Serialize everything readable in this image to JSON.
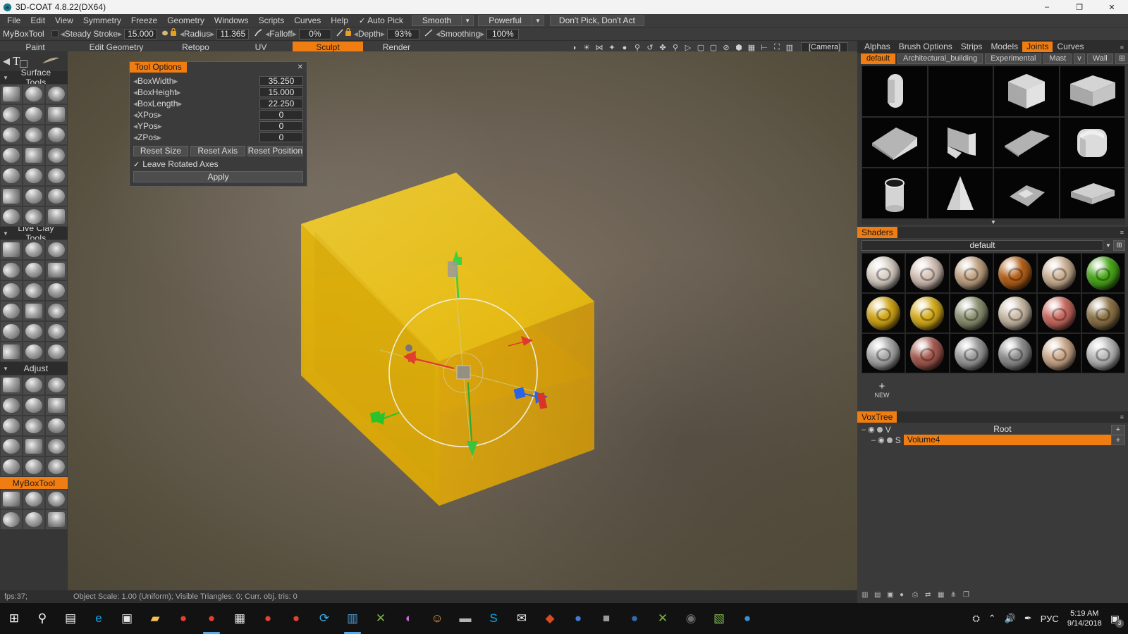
{
  "window": {
    "title": "3D-COAT 4.8.22(DX64)",
    "app_icon": "coat-logo-icon",
    "minimize": "–",
    "maximize": "❐",
    "close": "✕"
  },
  "menubar": {
    "items": [
      "File",
      "Edit",
      "View",
      "Symmetry",
      "Freeze",
      "Geometry",
      "Windows",
      "Scripts",
      "Curves",
      "Help"
    ],
    "auto_pick": {
      "label": "Auto Pick",
      "checked": true,
      "check_glyph": "✓"
    },
    "combo1": {
      "value": "Smooth",
      "arrow": "▼"
    },
    "combo2": {
      "value": "Powerful",
      "arrow": "▼"
    },
    "pick_mode": "Don't Pick, Don't Act"
  },
  "parambar": {
    "tool_name": "MyBoxTool",
    "params": [
      {
        "name": "steady-stroke",
        "label": "Steady Stroke",
        "value": "15.000",
        "toggle": true,
        "icon": ""
      },
      {
        "name": "radius",
        "label": "Radius",
        "value": "11.365",
        "toggle": false,
        "icon": "brush-lock-icon"
      },
      {
        "name": "falloff",
        "label": "Falloff",
        "value": "0%",
        "toggle": false,
        "icon": "falloff-curve-icon"
      },
      {
        "name": "depth",
        "label": "Depth",
        "value": "93%",
        "toggle": false,
        "icon": "depth-lock-icon"
      },
      {
        "name": "smoothing",
        "label": "Smoothing",
        "value": "100%",
        "toggle": false,
        "icon": "smoothing-icon"
      }
    ],
    "caret_left": "◂",
    "caret_right": "▸"
  },
  "room_tabs": {
    "items": [
      "Paint",
      "Edit Geometry",
      "Retopo",
      "UV",
      "Sculpt",
      "Render"
    ],
    "active": "Sculpt"
  },
  "viewport_toolbar": {
    "icons": [
      "contrast-icon",
      "light-bulb-icon",
      "environment-icon",
      "light-move-icon",
      "drop-icon",
      "rotate-horizon-icon",
      "undo-rotate-icon",
      "move-icon",
      "zoom-icon",
      "play-icon",
      "all-icon",
      "pen-icon",
      "no-symmetry-icon",
      "volume-icon",
      "grid-icon",
      "axis-icon",
      "fit-icon",
      "split-icon"
    ],
    "camera_label": "[Camera]"
  },
  "tool_options": {
    "title": "Tool Options",
    "close_glyph": "✕",
    "rows": [
      {
        "label": "BoxWidth",
        "value": "35.250"
      },
      {
        "label": "BoxHeight",
        "value": "15.000"
      },
      {
        "label": "BoxLength",
        "value": "22.250"
      },
      {
        "label": "XPos",
        "value": "0"
      },
      {
        "label": "YPos",
        "value": "0"
      },
      {
        "label": "ZPos",
        "value": "0"
      }
    ],
    "buttons": [
      "Reset Size",
      "Reset Axis",
      "Reset Position"
    ],
    "checkbox": {
      "label": "Leave Rotated Axes",
      "checked": true,
      "glyph": "✓"
    },
    "apply": "Apply"
  },
  "left_panel": {
    "header_icons": [
      "back-arrow-icon",
      "text-tool-icon",
      "alpha-stroke-icon"
    ],
    "sections": [
      {
        "name": "surface-tools",
        "label": "Surface Tools",
        "rows": 7,
        "tri": "▼"
      },
      {
        "name": "live-clay-tools",
        "label": "Live Clay Tools",
        "rows": 6,
        "tri": "▼"
      },
      {
        "name": "adjust",
        "label": "Adjust",
        "rows": 5,
        "tri": "▼"
      }
    ],
    "active_tool": "MyBoxTool",
    "trailing_rows": 2
  },
  "right_panel": {
    "tabs": [
      "Alphas",
      "Brush Options",
      "Strips",
      "Models",
      "Joints",
      "Curves"
    ],
    "active_tab": "Joints",
    "menu_arrow": "≡",
    "chips": [
      {
        "label": "default",
        "active": true
      },
      {
        "label": "Architectural_building",
        "active": false
      },
      {
        "label": "Experimental",
        "active": false
      },
      {
        "label": "Mast",
        "active": false
      },
      {
        "label": "v",
        "active": false
      },
      {
        "label": "Wall",
        "active": false
      }
    ],
    "chip_add_icon": "add-folder-icon",
    "models": [
      "capsule",
      "empty",
      "cube",
      "box-long",
      "wedge",
      "plane-fold",
      "ramp",
      "rounded-cube",
      "tube",
      "cone",
      "pyramid-cut",
      "slab"
    ],
    "scroll_glyph": "▼"
  },
  "shaders": {
    "title": "Shaders",
    "arrow": "≡",
    "selected": "default",
    "dropdown_arrow": "▼",
    "add_icon": "add-shader-icon",
    "swatches": [
      "#d9cfc6",
      "#d4c1b6",
      "#c2a484",
      "#b4611a",
      "#cdb294",
      "#4aa81a",
      "#d2a616",
      "#d7ad1c",
      "#8d9372",
      "#c9b9a5",
      "#c96a60",
      "#8d7347",
      "#a9a9a9",
      "#a65a50",
      "#9c9c9c",
      "#8e8e8e",
      "#cda98c",
      "#b9b9b9"
    ],
    "new_button": {
      "plus": "+",
      "label": "NEW"
    }
  },
  "voxtree": {
    "title": "VoxTree",
    "arrow": "≡",
    "rows": [
      {
        "indent": 0,
        "minus": "–",
        "eye": "◉",
        "type": "V",
        "name": "Root",
        "selected": false,
        "plus": "+"
      },
      {
        "indent": 1,
        "minus": "–",
        "eye": "◉",
        "type": "S",
        "name": "Volume4",
        "selected": true,
        "plus": "+"
      }
    ],
    "toolbar_icons": [
      "merge-icon",
      "lock-icon",
      "copy-icon",
      "sphere-icon",
      "printer-icon",
      "swap-icon",
      "grid-small-icon",
      "axis-small-icon",
      "transform-icon"
    ]
  },
  "statusbar": {
    "fps": "fps:37;",
    "info": "Object Scale: 1.00 (Uniform); Visible Triangles: 0; Curr. obj. tris: 0"
  },
  "taskbar": {
    "items": [
      {
        "name": "start-button",
        "icon": "⊞",
        "color": "#ffffff",
        "running": false
      },
      {
        "name": "search-button",
        "icon": "⚲",
        "color": "#ffffff",
        "running": false
      },
      {
        "name": "task-view-button",
        "icon": "▤",
        "color": "#ffffff",
        "running": false
      },
      {
        "name": "edge-browser",
        "icon": "e",
        "color": "#0ea5e9",
        "running": false
      },
      {
        "name": "microsoft-store",
        "icon": "▣",
        "color": "#e8e8e8",
        "running": false
      },
      {
        "name": "file-explorer",
        "icon": "▰",
        "color": "#f2c14e",
        "running": false
      },
      {
        "name": "chrome-1",
        "icon": "●",
        "color": "#e34133",
        "running": false
      },
      {
        "name": "chrome-2",
        "icon": "●",
        "color": "#e34133",
        "running": true
      },
      {
        "name": "calculator",
        "icon": "▦",
        "color": "#e8e8e8",
        "running": false
      },
      {
        "name": "chrome-3",
        "icon": "●",
        "color": "#e34133",
        "running": false
      },
      {
        "name": "chrome-4",
        "icon": "●",
        "color": "#e34133",
        "running": false
      },
      {
        "name": "teamviewer",
        "icon": "⟳",
        "color": "#3ba9e0",
        "running": false
      },
      {
        "name": "notepad-app",
        "icon": "▥",
        "color": "#4ea3e0",
        "running": true
      },
      {
        "name": "skype-meetings",
        "icon": "✕",
        "color": "#7bb93a",
        "running": false
      },
      {
        "name": "paint-3d",
        "icon": "◐",
        "color": "#c46bd6",
        "running": false
      },
      {
        "name": "smiley-app",
        "icon": "☺",
        "color": "#f2a13c",
        "running": false
      },
      {
        "name": "terminal-app",
        "icon": "▬",
        "color": "#b5b5b5",
        "running": false
      },
      {
        "name": "skype",
        "icon": "S",
        "color": "#00aff0",
        "running": false
      },
      {
        "name": "mail-app",
        "icon": "✉",
        "color": "#f0f0f0",
        "running": false
      },
      {
        "name": "office-app",
        "icon": "◆",
        "color": "#d84b20",
        "running": false
      },
      {
        "name": "blue-app-1",
        "icon": "●",
        "color": "#3c7fd0",
        "running": false
      },
      {
        "name": "gray-app",
        "icon": "■",
        "color": "#9a9a9a",
        "running": false
      },
      {
        "name": "blue-app-2",
        "icon": "●",
        "color": "#2f6fb0",
        "running": false
      },
      {
        "name": "skype-green",
        "icon": "✕",
        "color": "#7bb93a",
        "running": false
      },
      {
        "name": "dark-app",
        "icon": "◉",
        "color": "#6d6d6d",
        "running": false
      },
      {
        "name": "green-doc-app",
        "icon": "▧",
        "color": "#7ab648",
        "running": false
      },
      {
        "name": "blue-app-3",
        "icon": "●",
        "color": "#3c8fd0",
        "running": false
      }
    ],
    "tray": {
      "people_icon": "⛭",
      "chevron_icon": "⌃",
      "volume_icon": "🔊",
      "pen_icon": "✒",
      "language": "РУС",
      "time": "5:19 AM",
      "date": "9/14/2018",
      "notif_icon": "▣",
      "notif_count": "3"
    }
  },
  "colors": {
    "accent": "#f07d12",
    "panel_bg": "#3a3a3a",
    "dark_bg": "#2d2d2d",
    "viewport_bg": "#6b6154",
    "object_color": "#f0b400"
  }
}
